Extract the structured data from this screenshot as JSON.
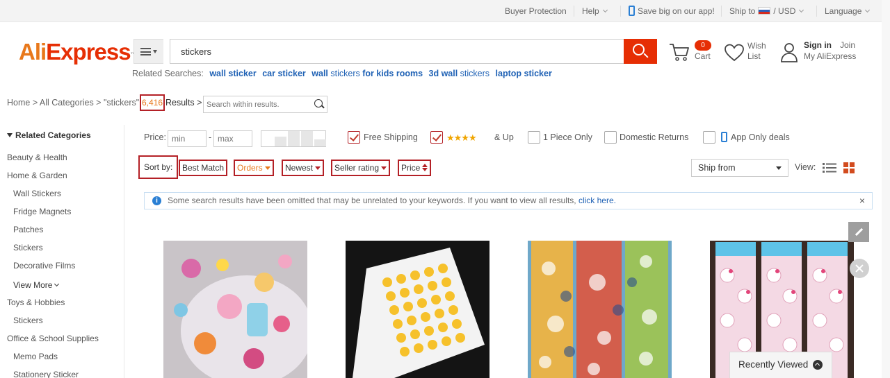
{
  "topbar": {
    "buyer_protection": "Buyer Protection",
    "help": "Help",
    "app_promo": "Save big on our app!",
    "ship_to": "Ship to",
    "currency_sep": "/",
    "currency": "USD",
    "language": "Language"
  },
  "header": {
    "logo_ali": "Ali",
    "logo_express": "Express",
    "logo_tm": "™",
    "search_value": "stickers",
    "cart_count": "0",
    "cart_label": "Cart",
    "wish_line1": "Wish",
    "wish_line2": "List",
    "sign_in": "Sign in",
    "join": "Join",
    "my_aliexpress": "My AliExpress"
  },
  "related": {
    "label": "Related Searches:",
    "items": [
      {
        "bold": "wall sticker",
        "rest": ""
      },
      {
        "bold": "car sticker",
        "rest": ""
      },
      {
        "bold": "wall",
        "rest": " stickers ",
        "bold2": "for kids rooms"
      },
      {
        "bold": "3d wall",
        "rest": " stickers"
      },
      {
        "bold": "laptop sticker",
        "rest": ""
      }
    ]
  },
  "breadcrumb": {
    "text": "Home > All Categories > \"stickers\"",
    "count": "6,416",
    "results": "Results >",
    "within_placeholder": "Search within results."
  },
  "sidebar": {
    "heading": "Related Categories",
    "items": [
      {
        "label": "Beauty & Health",
        "level": 0
      },
      {
        "label": "Home & Garden",
        "level": 0
      },
      {
        "label": "Wall Stickers",
        "level": 1
      },
      {
        "label": "Fridge Magnets",
        "level": 1
      },
      {
        "label": "Patches",
        "level": 1
      },
      {
        "label": "Stickers",
        "level": 1
      },
      {
        "label": "Decorative Films",
        "level": 1
      },
      {
        "label": "View More",
        "level": 1
      },
      {
        "label": "Toys & Hobbies",
        "level": 0
      },
      {
        "label": "Stickers",
        "level": 1
      },
      {
        "label": "Office & School Supplies",
        "level": 0
      },
      {
        "label": "Memo Pads",
        "level": 1
      },
      {
        "label": "Stationery Sticker",
        "level": 1
      }
    ]
  },
  "filters": {
    "price_label": "Price:",
    "min_placeholder": "min",
    "dash": "-",
    "max_placeholder": "max",
    "free_shipping": "Free Shipping",
    "free_shipping_checked": true,
    "rating_stars": "★★★★",
    "rating_suffix": "& Up",
    "rating_checked": true,
    "one_piece": "1 Piece Only",
    "domestic_returns": "Domestic Returns",
    "app_only": "App Only deals"
  },
  "sort": {
    "label": "Sort by:",
    "best_match": "Best Match",
    "orders": "Orders",
    "newest": "Newest",
    "seller_rating": "Seller rating",
    "price": "Price",
    "ship_from": "Ship from",
    "view_label": "View:"
  },
  "notice": {
    "text": "Some search results have been omitted that may be unrelated to your keywords. If you want to view all results, ",
    "link": "click here.",
    "close": "×"
  },
  "widgets": {
    "recently_viewed": "Recently Viewed"
  },
  "colors": {
    "brand_orange": "#e8781b",
    "brand_red": "#e62e04",
    "highlight_border": "#b42026",
    "link_blue": "#2062b5"
  }
}
